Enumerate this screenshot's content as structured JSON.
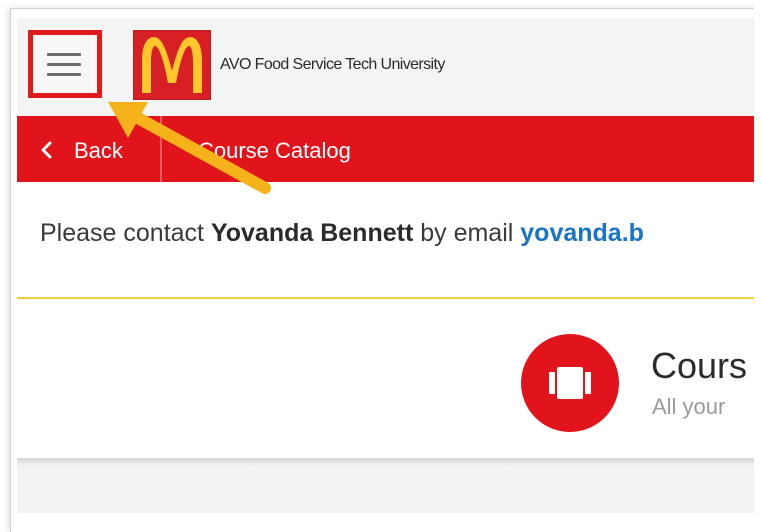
{
  "header": {
    "menu_icon": "hamburger-menu-icon",
    "logo_icon": "golden-arches-logo",
    "brand_name": "AVO Food Service Tech University"
  },
  "nav": {
    "back_label": "Back",
    "back_icon": "chevron-left-icon",
    "title": "Course Catalog"
  },
  "contact": {
    "prefix": "Please contact ",
    "name": "Yovanda Bennett",
    "middle": " by email ",
    "email": "yovanda.b"
  },
  "catalog": {
    "icon": "course-catalog-icon",
    "title": "Cours",
    "subtitle": "All your"
  },
  "annotation": {
    "arrow_color": "#f5b21a",
    "highlight_color": "#e01b1b"
  },
  "colors": {
    "brand_red": "#e1141c",
    "link_blue": "#1a73c4",
    "divider_gold": "#f0cf3a"
  }
}
